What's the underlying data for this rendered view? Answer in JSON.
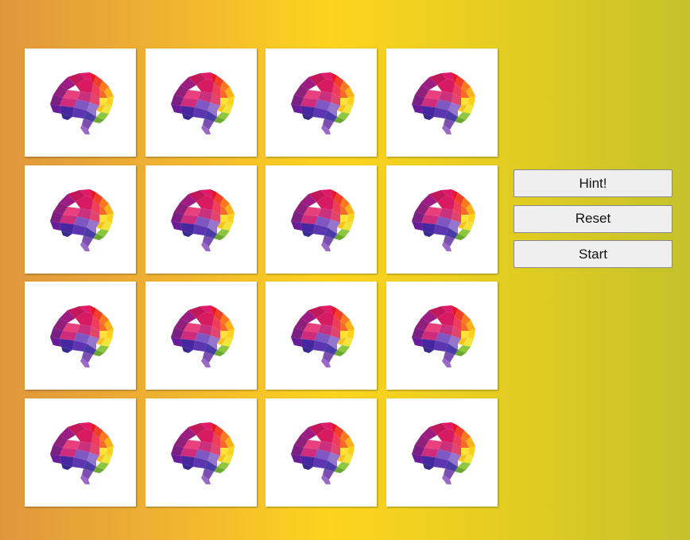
{
  "board": {
    "card_back_icon": "polygonal-rainbow-brain-icon",
    "rows": 4,
    "columns": 4,
    "cards": [
      {
        "face": "hidden"
      },
      {
        "face": "hidden"
      },
      {
        "face": "hidden"
      },
      {
        "face": "hidden"
      },
      {
        "face": "hidden"
      },
      {
        "face": "hidden"
      },
      {
        "face": "hidden"
      },
      {
        "face": "hidden"
      },
      {
        "face": "hidden"
      },
      {
        "face": "hidden"
      },
      {
        "face": "hidden"
      },
      {
        "face": "hidden"
      },
      {
        "face": "hidden"
      },
      {
        "face": "hidden"
      },
      {
        "face": "hidden"
      },
      {
        "face": "hidden"
      }
    ]
  },
  "controls": {
    "hint_label": "Hint!",
    "reset_label": "Reset",
    "start_label": "Start"
  },
  "colors": {
    "background_gradient": [
      "#e0963e",
      "#f0b430",
      "#fdd41e",
      "#e2cc22",
      "#c4c22a"
    ],
    "card_background": "#ffffff",
    "button_background": "#efefef"
  }
}
